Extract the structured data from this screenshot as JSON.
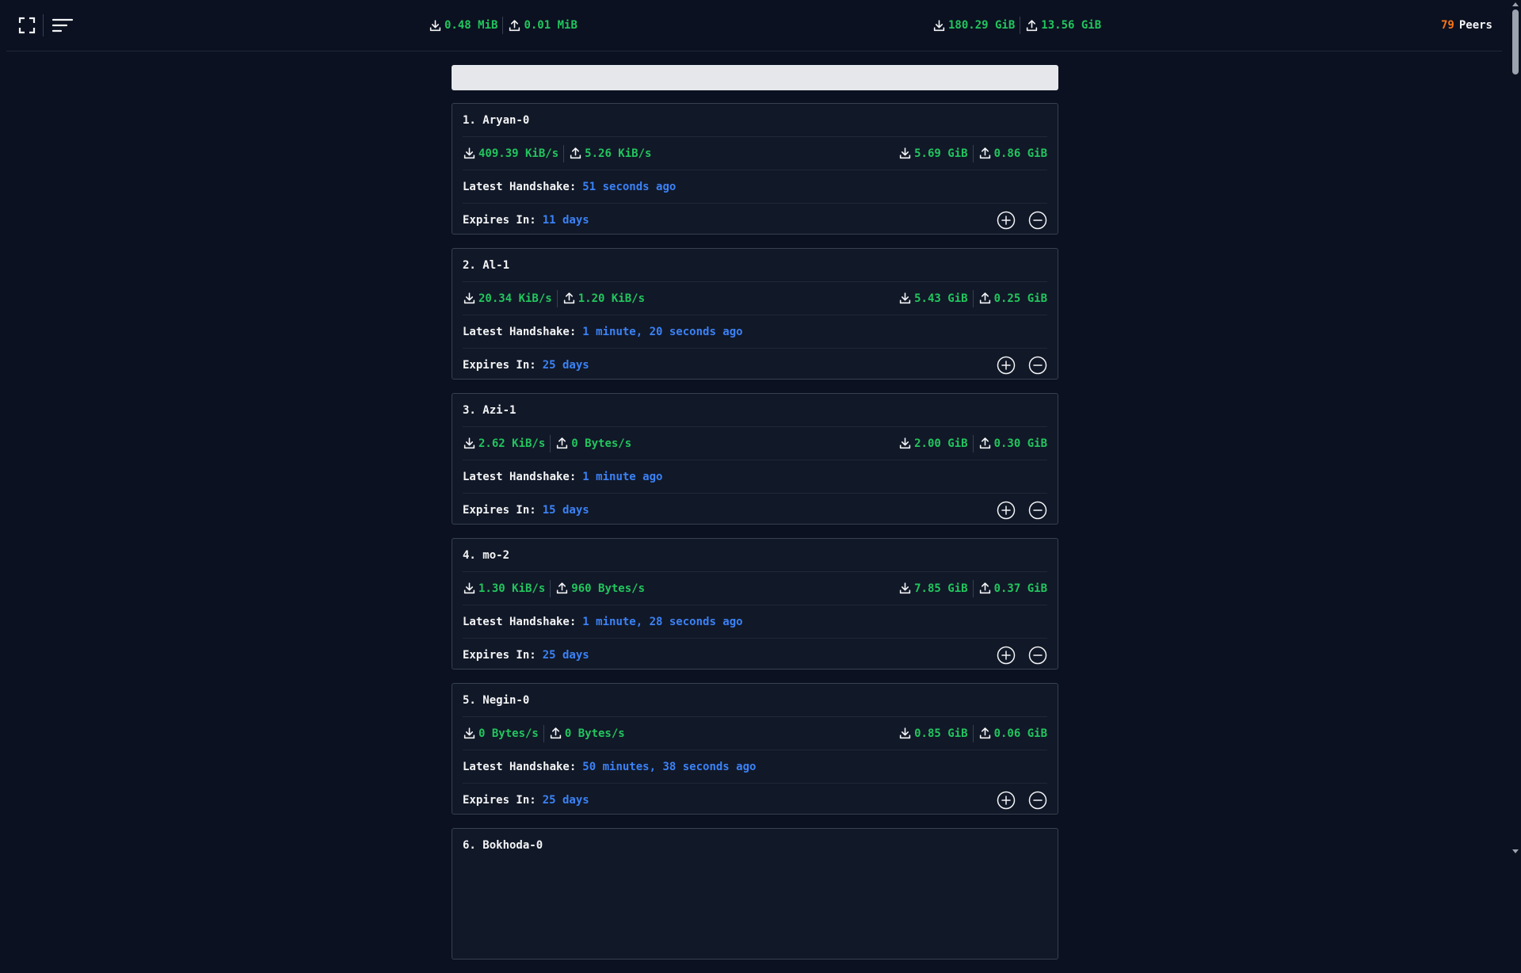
{
  "header": {
    "fullscreen_icon": "fullscreen-icon",
    "menu_icon": "menu-icon",
    "rate": {
      "download": "0.48 MiB",
      "upload": "0.01 MiB"
    },
    "total": {
      "download": "180.29 GiB",
      "upload": "13.56 GiB"
    },
    "peers_count": "79",
    "peers_label": "Peers"
  },
  "search": {
    "placeholder": ""
  },
  "labels": {
    "latest_handshake": "Latest Handshake:",
    "expires_in": "Expires In:"
  },
  "peers": [
    {
      "name": "1. Aryan-0",
      "rx_rate": "409.39 KiB/s",
      "tx_rate": "5.26 KiB/s",
      "rx_total": "5.69 GiB",
      "tx_total": "0.86 GiB",
      "handshake": "51 seconds ago",
      "expires": "11 days"
    },
    {
      "name": "2. Al-1",
      "rx_rate": "20.34 KiB/s",
      "tx_rate": "1.20 KiB/s",
      "rx_total": "5.43 GiB",
      "tx_total": "0.25 GiB",
      "handshake": "1 minute, 20 seconds ago",
      "expires": "25 days"
    },
    {
      "name": "3. Azi-1",
      "rx_rate": "2.62 KiB/s",
      "tx_rate": "0 Bytes/s",
      "rx_total": "2.00 GiB",
      "tx_total": "0.30 GiB",
      "handshake": "1 minute ago",
      "expires": "15 days"
    },
    {
      "name": "4. mo-2",
      "rx_rate": "1.30 KiB/s",
      "tx_rate": "960 Bytes/s",
      "rx_total": "7.85 GiB",
      "tx_total": "0.37 GiB",
      "handshake": "1 minute, 28 seconds ago",
      "expires": "25 days"
    },
    {
      "name": "5. Negin-0",
      "rx_rate": "0 Bytes/s",
      "tx_rate": "0 Bytes/s",
      "rx_total": "0.85 GiB",
      "tx_total": "0.06 GiB",
      "handshake": "50 minutes, 38 seconds ago",
      "expires": "25 days"
    },
    {
      "name": "6. Bokhoda-0"
    }
  ],
  "colors": {
    "background": "#0b1120",
    "card": "#111827",
    "green": "#22c55e",
    "blue": "#3b82f6",
    "orange": "#f97316"
  }
}
